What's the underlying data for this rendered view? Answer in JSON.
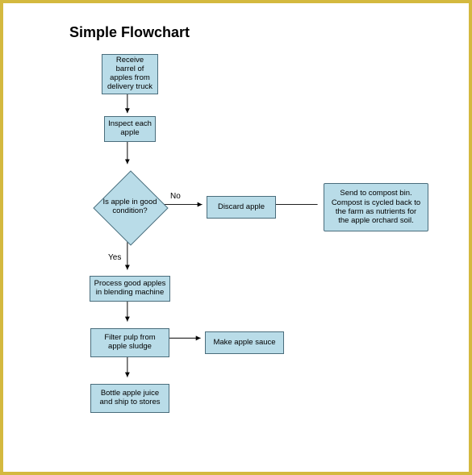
{
  "title": "Simple Flowchart",
  "nodes": {
    "receive": "Receive barrel of apples from delivery truck",
    "inspect": "Inspect each apple",
    "decision": "Is apple in good condition?",
    "discard": "Discard apple",
    "compost_note": "Send to compost bin. Compost is cycled back to the farm as nutrients for the apple orchard soil.",
    "process": "Process good apples in blending machine",
    "filter": "Filter pulp from apple sludge",
    "make_sauce": "Make apple sauce",
    "bottle": "Bottle apple juice and ship to stores"
  },
  "labels": {
    "yes": "Yes",
    "no": "No"
  }
}
